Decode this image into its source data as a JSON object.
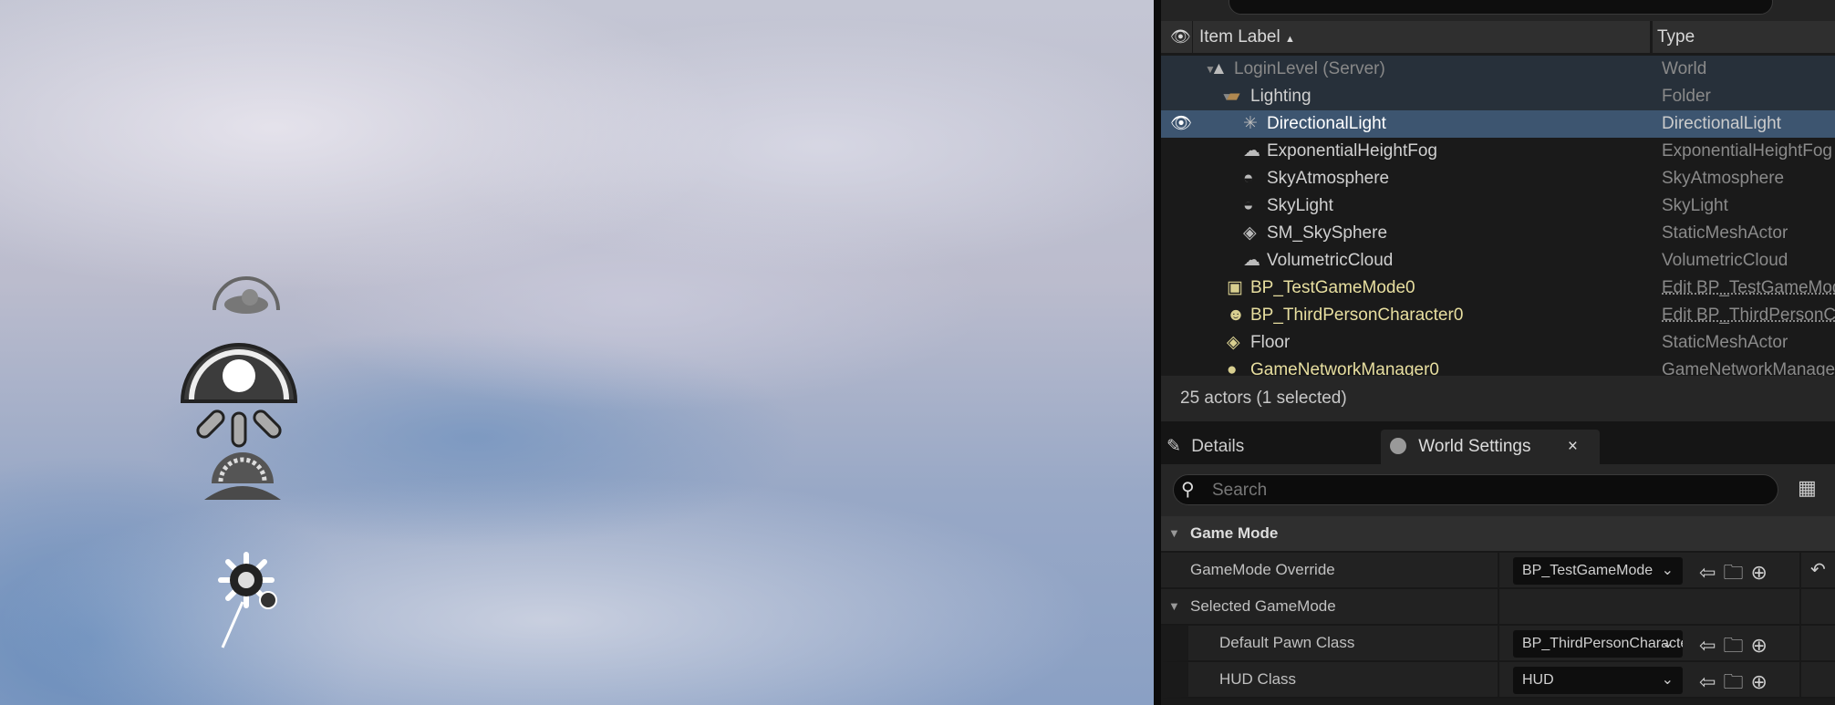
{
  "outliner": {
    "columns": {
      "item_label": "Item Label",
      "sort_indicator": "▲",
      "type": "Type"
    },
    "rows": [
      {
        "label": "LoginLevel (Server)",
        "type": "World",
        "icon": "world-icon"
      },
      {
        "label": "Lighting",
        "type": "Folder",
        "icon": "folder-icon"
      },
      {
        "label": "DirectionalLight",
        "type": "DirectionalLight",
        "icon": "directional-light-icon",
        "selected": true
      },
      {
        "label": "ExponentialHeightFog",
        "type": "ExponentialHeightFog",
        "icon": "fog-icon"
      },
      {
        "label": "SkyAtmosphere",
        "type": "SkyAtmosphere",
        "icon": "sky-atmosphere-icon"
      },
      {
        "label": "SkyLight",
        "type": "SkyLight",
        "icon": "sky-light-icon"
      },
      {
        "label": "SM_SkySphere",
        "type": "StaticMeshActor",
        "icon": "static-mesh-icon"
      },
      {
        "label": "VolumetricCloud",
        "type": "VolumetricCloud",
        "icon": "cloud-icon"
      },
      {
        "label": "BP_TestGameMode0",
        "type": "Edit BP_TestGameMode",
        "icon": "game-mode-icon"
      },
      {
        "label": "BP_ThirdPersonCharacter0",
        "type": "Edit BP_ThirdPersonCharacter",
        "icon": "character-icon"
      },
      {
        "label": "Floor",
        "type": "StaticMeshActor",
        "icon": "static-mesh-icon"
      },
      {
        "label": "GameNetworkManager0",
        "type": "GameNetworkManager",
        "icon": "actor-icon"
      }
    ],
    "status": "25 actors (1 selected)"
  },
  "details": {
    "tabs": [
      {
        "label": "Details"
      },
      {
        "label": "World Settings",
        "active": true
      }
    ],
    "close": "×",
    "search_placeholder": "Search",
    "category": "Game Mode",
    "gamemode_override": {
      "label": "GameMode Override",
      "value": "BP_TestGameMode"
    },
    "selected_gamemode": "Selected GameMode",
    "default_pawn": {
      "label": "Default Pawn Class",
      "value": "BP_ThirdPersonCharacter"
    },
    "hud": {
      "label": "HUD Class",
      "value": "HUD"
    }
  },
  "colors": {
    "selected_row": "#3d5570",
    "actor_blueprint_text": "#e8dfa0",
    "link": "#5aa0f0"
  }
}
